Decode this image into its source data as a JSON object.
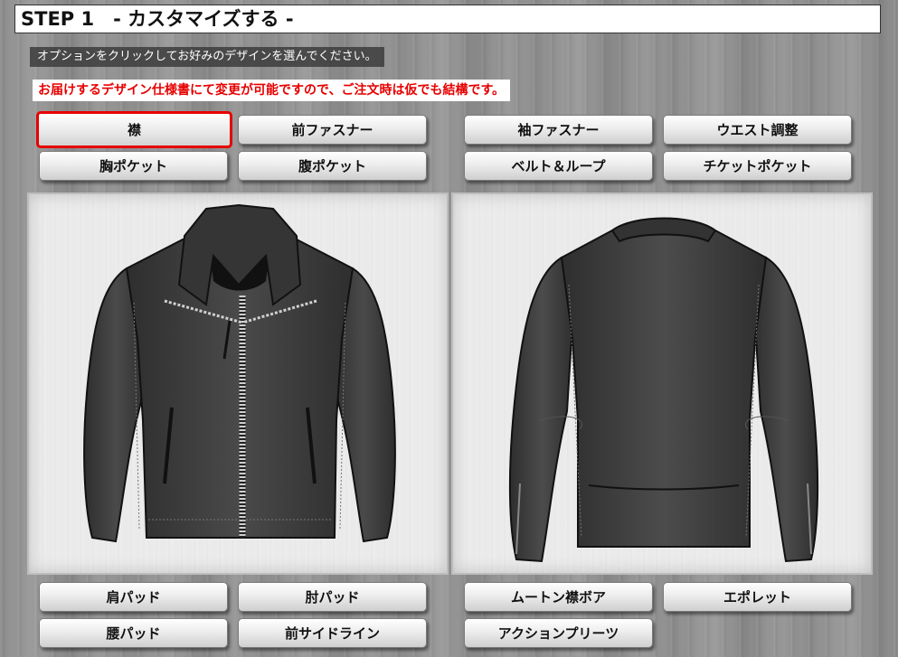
{
  "header": {
    "step_title": "STEP 1　- カスタマイズする -"
  },
  "instruction_text": "オプションをクリックしてお好みのデザインを選んでください。",
  "notice_text": "お届けするデザイン仕様書にて変更が可能ですので、ご注文時は仮でも結構です。",
  "top_options": [
    {
      "label": "襟",
      "selected": true
    },
    {
      "label": "前ファスナー"
    },
    {
      "label": "袖ファスナー"
    },
    {
      "label": "ウエスト調整"
    },
    {
      "label": "胸ポケット"
    },
    {
      "label": "腹ポケット"
    },
    {
      "label": "ベルト＆ループ"
    },
    {
      "label": "チケットポケット"
    }
  ],
  "bottom_options": [
    {
      "label": "肩パッド"
    },
    {
      "label": "肘パッド"
    },
    {
      "label": "ムートン襟ボア"
    },
    {
      "label": "エポレット"
    },
    {
      "label": "腰パッド"
    },
    {
      "label": "前サイドライン"
    },
    {
      "label": "アクションプリーツ"
    }
  ],
  "colors": {
    "selected_border": "#e60000",
    "notice_text": "#e60000",
    "jacket_fill": "#3c3c3c",
    "panel_bg": "#ececec"
  }
}
